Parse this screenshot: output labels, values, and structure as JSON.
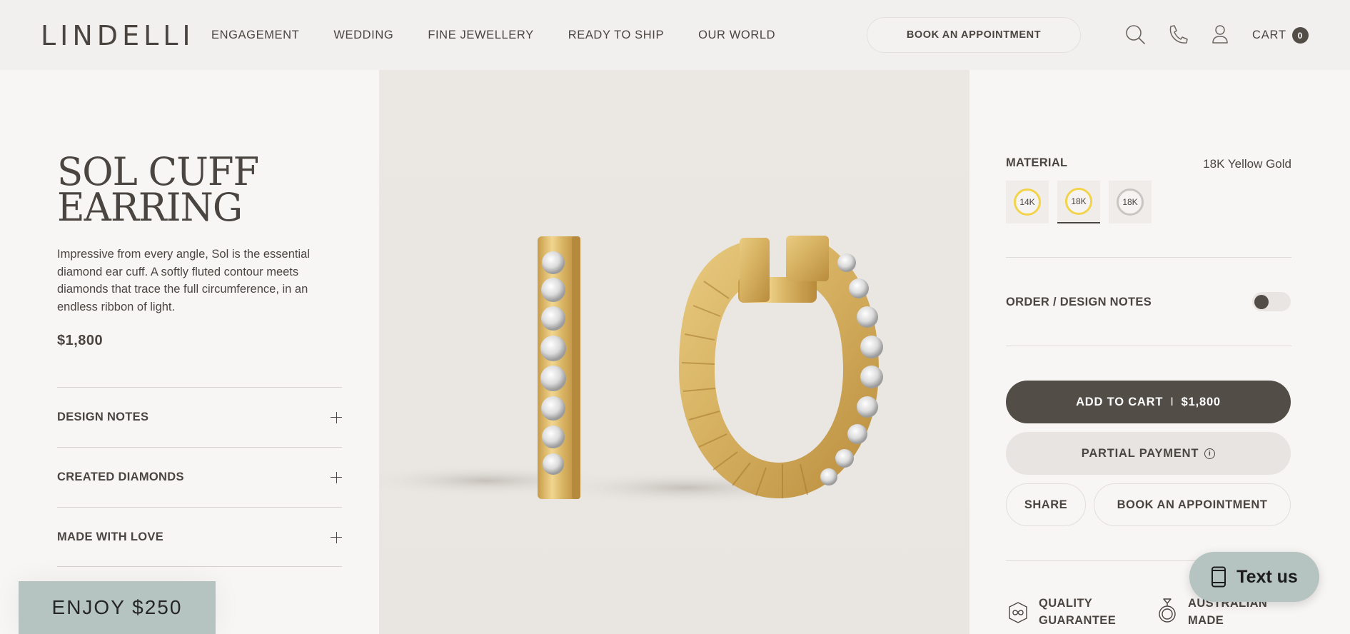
{
  "header": {
    "logo": "LINDELLI",
    "nav": [
      "ENGAGEMENT",
      "WEDDING",
      "FINE JEWELLERY",
      "READY TO SHIP",
      "OUR WORLD"
    ],
    "book_label": "BOOK AN APPOINTMENT",
    "cart_label": "CART",
    "cart_count": "0"
  },
  "product": {
    "title": "SOL CUFF\nEARRING",
    "description": "Impressive from every angle, Sol is the essential diamond ear cuff.  A softly fluted contour meets diamonds that trace the full circumference, in an endless ribbon of light.",
    "price": "$1,800",
    "accordions": [
      "DESIGN NOTES",
      "CREATED DIAMONDS",
      "MADE WITH LOVE"
    ]
  },
  "promo": {
    "enjoy": "ENJOY $250"
  },
  "options": {
    "material_label": "MATERIAL",
    "material_value": "18K Yellow Gold",
    "swatches": [
      {
        "label": "14K",
        "color": "#f2d34a"
      },
      {
        "label": "18K",
        "color": "#f2d34a"
      },
      {
        "label": "18K",
        "color": "#c9c6c2"
      }
    ],
    "notes_label": "ORDER / DESIGN NOTES"
  },
  "actions": {
    "add_to_cart": "ADD TO CART",
    "add_sep": "I",
    "add_price": "$1,800",
    "partial": "PARTIAL PAYMENT",
    "share": "SHARE",
    "book": "BOOK AN APPOINTMENT"
  },
  "features": [
    "QUALITY\nGUARANTEE",
    "AUSTRALIAN\nMADE"
  ],
  "chat": {
    "label": "Text us"
  },
  "colors": {
    "accent": "#524d47",
    "sage": "#b5c4c0",
    "gold": "#d8b765"
  }
}
